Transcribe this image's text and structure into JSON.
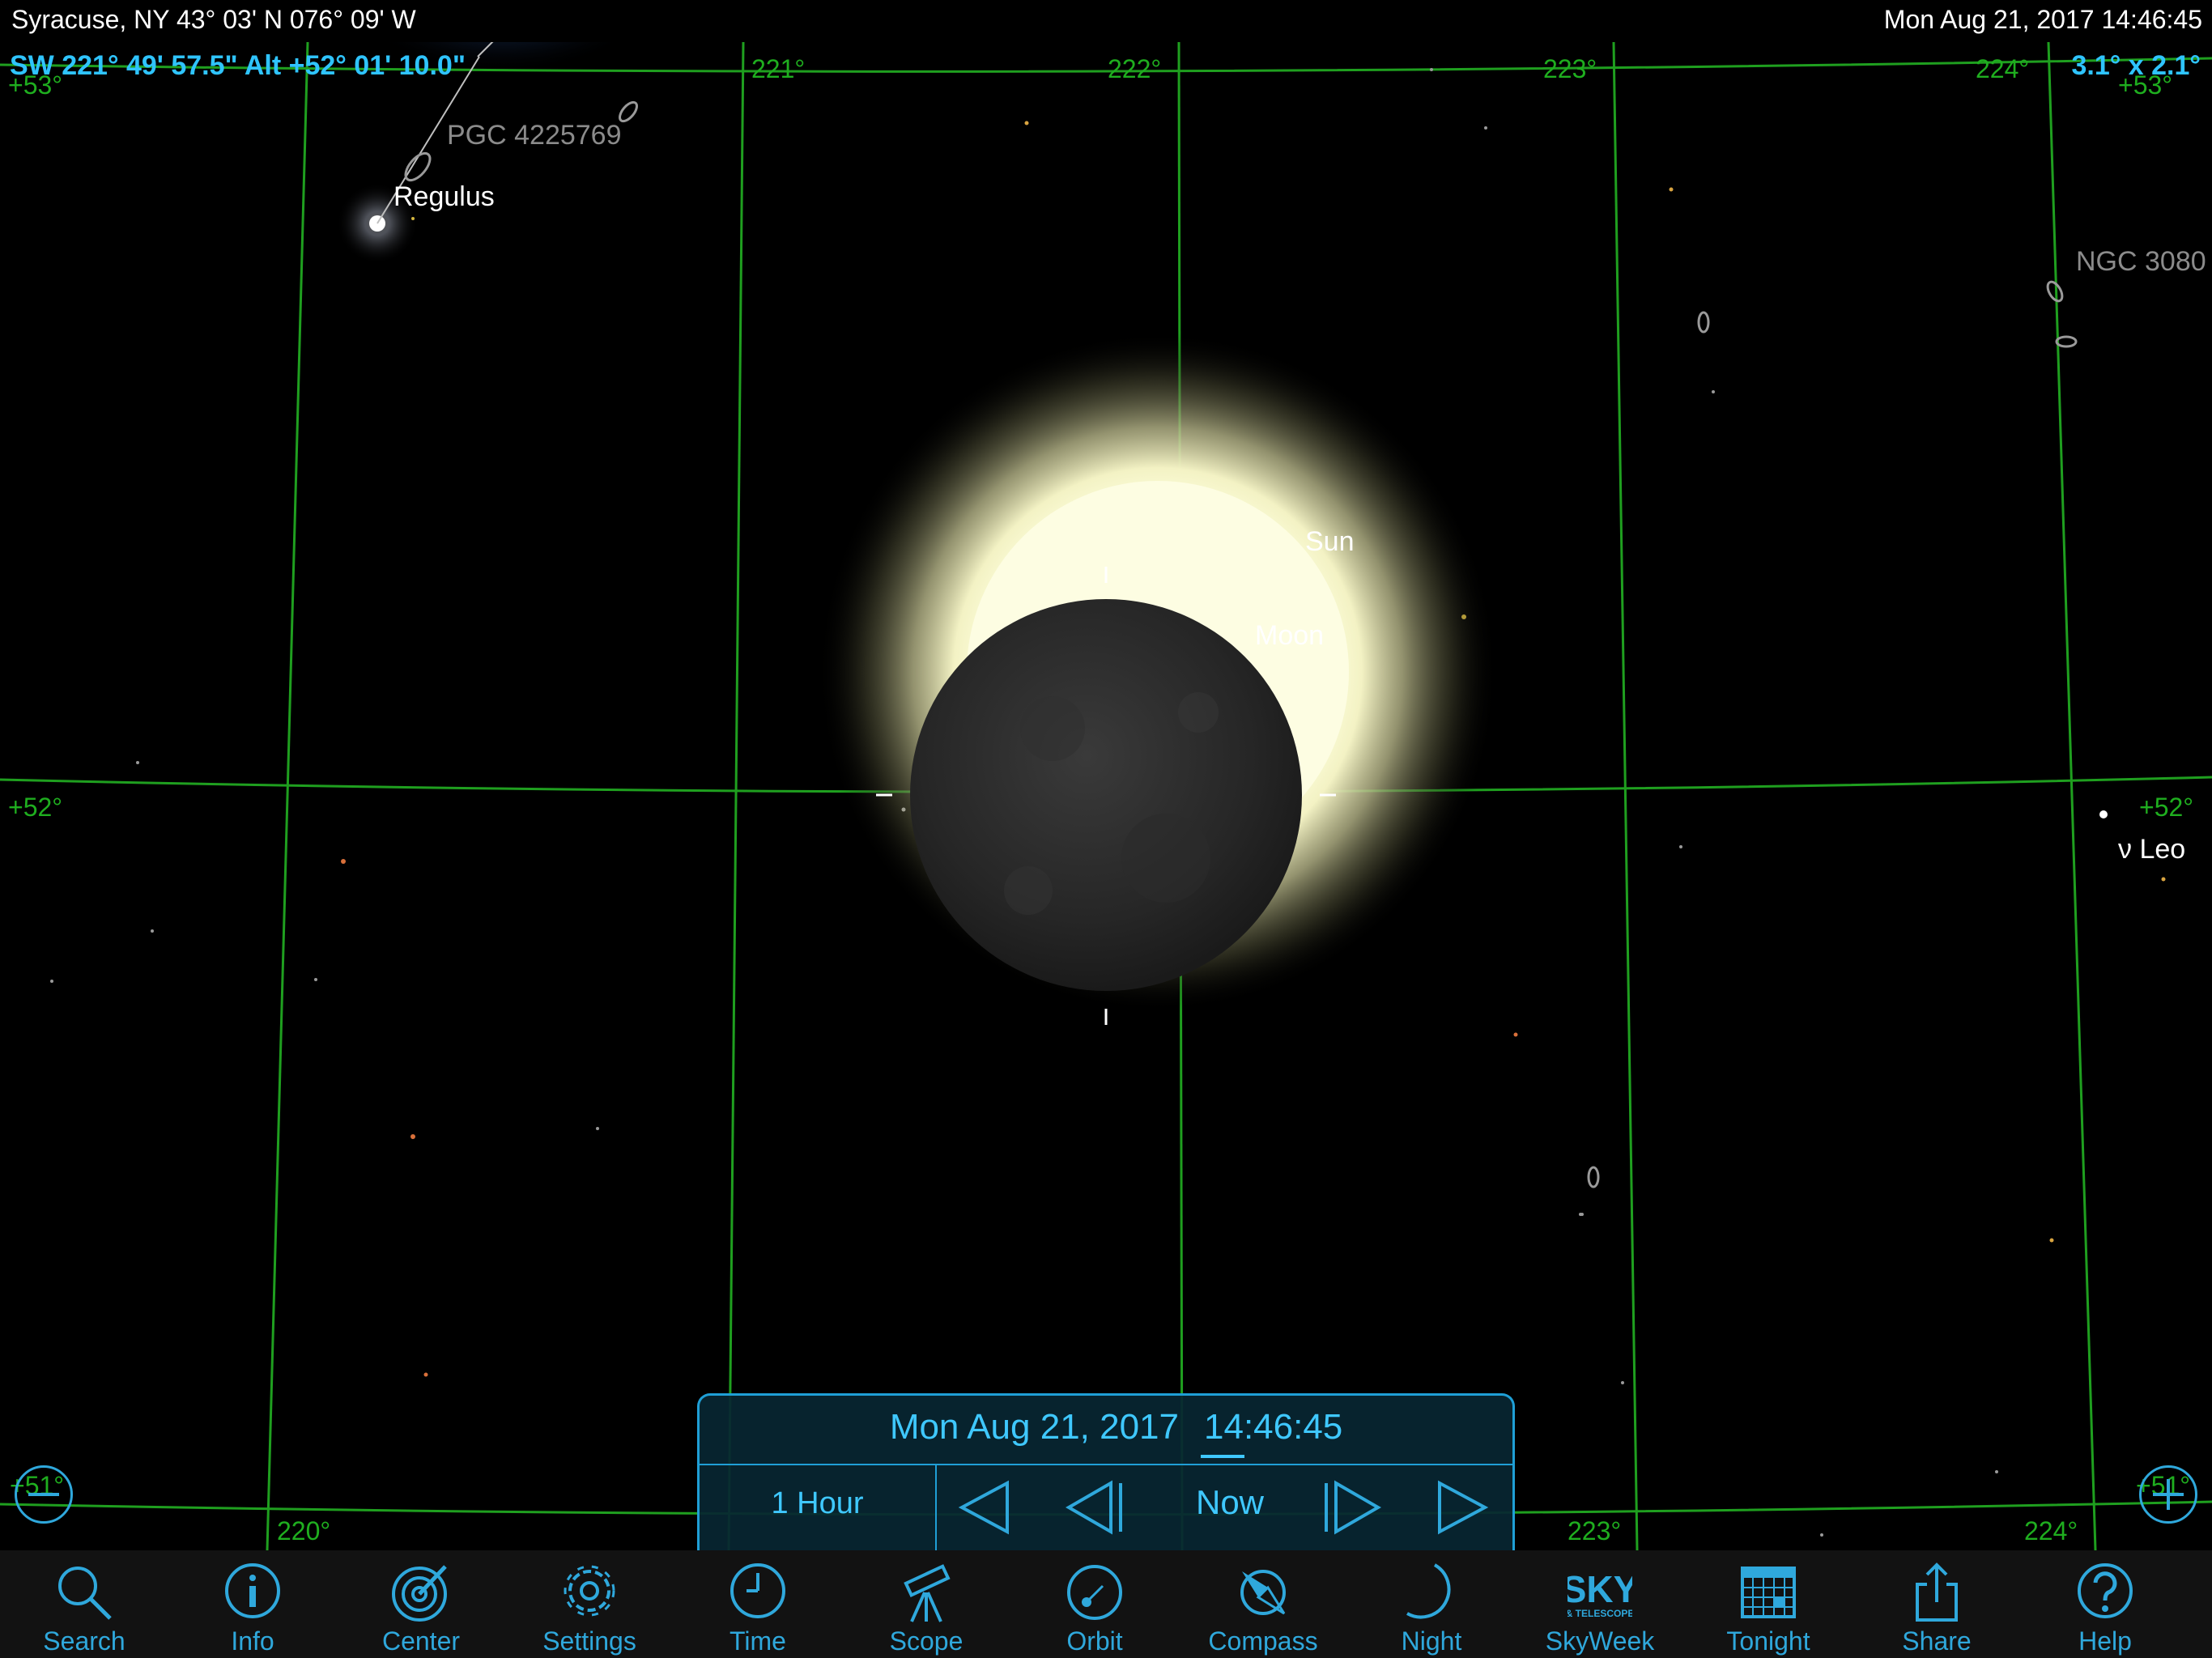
{
  "status_bar": {
    "location": "Syracuse, NY  43° 03' N 076° 09' W",
    "datetime": "Mon Aug 21, 2017  14:46:45"
  },
  "readout": {
    "position": "SW 221° 49' 57.5\" Alt +52° 01' 10.0\"",
    "field_of_view": "3.1° x  2.1°"
  },
  "grid": {
    "azimuth_labels": [
      "220°",
      "221°",
      "222°",
      "223°",
      "224°"
    ],
    "altitude_labels": [
      "+53°",
      "+52°",
      "+51°"
    ]
  },
  "objects": {
    "regulus": "Regulus",
    "pgc": "PGC 4225769",
    "ngc": "NGC 3080",
    "nu_leo": "ν Leo",
    "sun": "Sun",
    "moon": "Moon"
  },
  "time_panel": {
    "date": "Mon Aug 21, 2017",
    "time": "14:46:45",
    "step": "1 Hour",
    "now": "Now"
  },
  "toolbar": {
    "items": [
      {
        "label": "Search",
        "icon": "search-icon"
      },
      {
        "label": "Info",
        "icon": "info-icon"
      },
      {
        "label": "Center",
        "icon": "target-icon"
      },
      {
        "label": "Settings",
        "icon": "gear-icon"
      },
      {
        "label": "Time",
        "icon": "clock-icon"
      },
      {
        "label": "Scope",
        "icon": "telescope-icon"
      },
      {
        "label": "Orbit",
        "icon": "orbit-icon"
      },
      {
        "label": "Compass",
        "icon": "compass-icon"
      },
      {
        "label": "Night",
        "icon": "moon-crescent-icon"
      },
      {
        "label": "SkyWeek",
        "icon": "sky-telescope-logo-icon"
      },
      {
        "label": "Tonight",
        "icon": "calendar-icon"
      },
      {
        "label": "Share",
        "icon": "share-icon"
      },
      {
        "label": "Help",
        "icon": "help-icon"
      }
    ],
    "sky_logo": {
      "top": "SKY",
      "bottom": "& TELESCOPE"
    }
  },
  "colors": {
    "accent": "#2fa8dc",
    "readout": "#2fc4ff",
    "grid": "#1fae1f",
    "panel": "#082632"
  }
}
